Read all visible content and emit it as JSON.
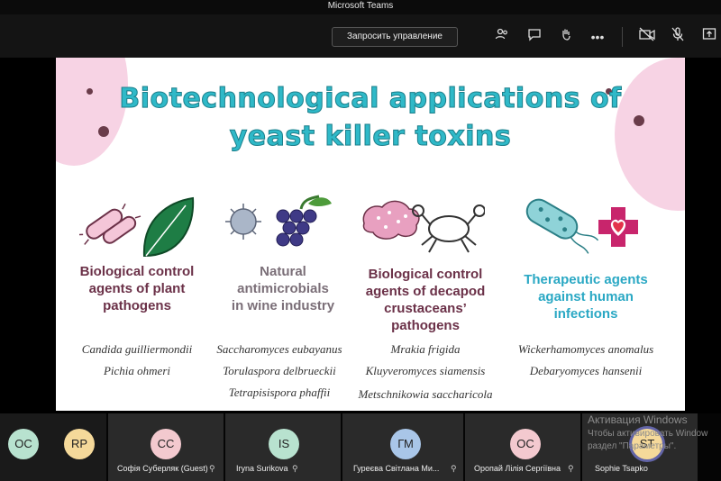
{
  "window": {
    "title": "Microsoft Teams"
  },
  "toolbar": {
    "request_control_label": "Запросить управление",
    "icons": [
      "people-icon",
      "chat-icon",
      "raise-hand-icon",
      "more-icon",
      "camera-off-icon",
      "mic-off-icon",
      "share-icon"
    ]
  },
  "slide": {
    "title_line1": "Biotechnological applications of",
    "title_line2": "yeast killer toxins",
    "categories": [
      {
        "line1": "Biological control",
        "line2": "agents of plant",
        "line3": "pathogens",
        "species": [
          "Candida guilliermondii",
          "Pichia ohmeri"
        ]
      },
      {
        "line1": "Natural",
        "line2": "antimicrobials",
        "line3": "in wine industry",
        "species": [
          "Saccharomyces  eubayanus",
          "Torulaspora delbrueckii",
          "Tetrapisispora phaffii"
        ]
      },
      {
        "line1": "Biological control",
        "line2": "agents of decapod",
        "line3": "crustaceans’",
        "line4": "pathogens",
        "species": [
          "Mrakia frigida",
          "Kluyveromyces siamensis",
          "Metschnikowia saccharicola"
        ]
      },
      {
        "line1": "Therapeutic agents",
        "line2": "against human",
        "line3": "infections",
        "species": [
          "Wickerhamomyces anomalus",
          "Debaryomyces hansenii"
        ]
      }
    ]
  },
  "participants": [
    {
      "initials": "OC",
      "name": "",
      "color": "#b8e2cf"
    },
    {
      "initials": "RP",
      "name": "",
      "color": "#f5d99a"
    },
    {
      "initials": "CC",
      "name": "Софія Суберляк (Guest)",
      "color": "#f3c9cf"
    },
    {
      "initials": "IS",
      "name": "Iryna Surikova",
      "color": "#b8e2cf"
    },
    {
      "initials": "ГМ",
      "name": "Гуреєва Світлана Ми...",
      "color": "#a9c6e8"
    },
    {
      "initials": "OC",
      "name": "Оропай Лілія Сергіївна",
      "color": "#f3c9cf"
    },
    {
      "initials": "ST",
      "name": "Sophie Tsapko",
      "color": "#f5d99a"
    }
  ],
  "watermark": {
    "line1": "Активация Windows",
    "line2": "Чтобы активировать Window",
    "line3": "раздел \"Параметры\"."
  }
}
